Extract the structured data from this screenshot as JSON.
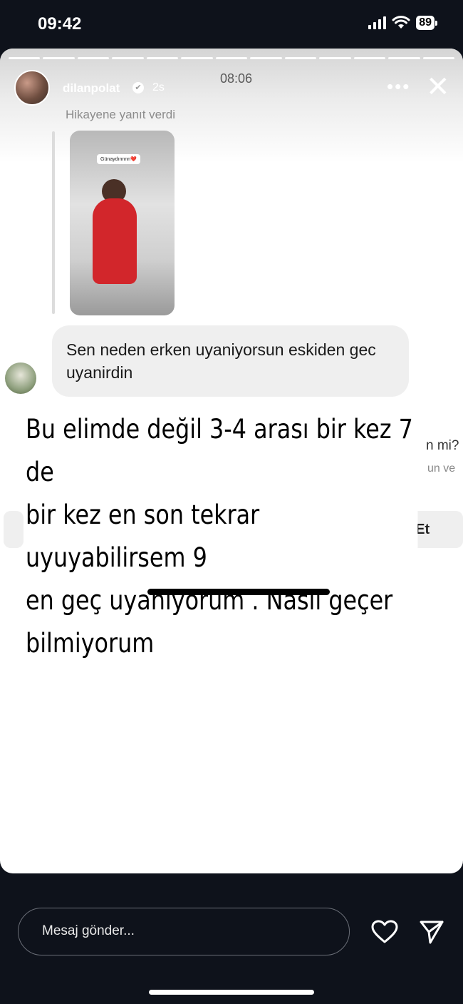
{
  "status_bar": {
    "time": "09:42",
    "battery": "89"
  },
  "story": {
    "progress_segments": 13,
    "username": "dilanpolat",
    "time_ago": "2s",
    "clock": "08:06",
    "replied_label": "Hikayene yanıt verdi",
    "sticker_text": "Günaydınnnn❤️",
    "message": "Sen neden erken uyaniyorsun eskiden gec uyanirdin",
    "fragments": {
      "top_right": "n mi?",
      "sub_right": "un ve",
      "accept": "Kabul Et"
    },
    "overlay_lines": [
      "Bu elimde değil 3-4 arası bir kez 7 de",
      "bir kez en son tekrar uyuyabilirsem 9",
      "en geç uyanıyorum . Nasıl geçer",
      "bilmiyorum"
    ]
  },
  "composer": {
    "placeholder": "Mesaj gönder..."
  },
  "colors": {
    "background": "#0e121b",
    "card": "#ffffff",
    "bubble": "#efefef"
  },
  "icons": [
    "signal-icon",
    "wifi-icon",
    "battery-icon",
    "verified-icon",
    "more-icon",
    "close-icon",
    "heart-icon",
    "send-icon"
  ]
}
